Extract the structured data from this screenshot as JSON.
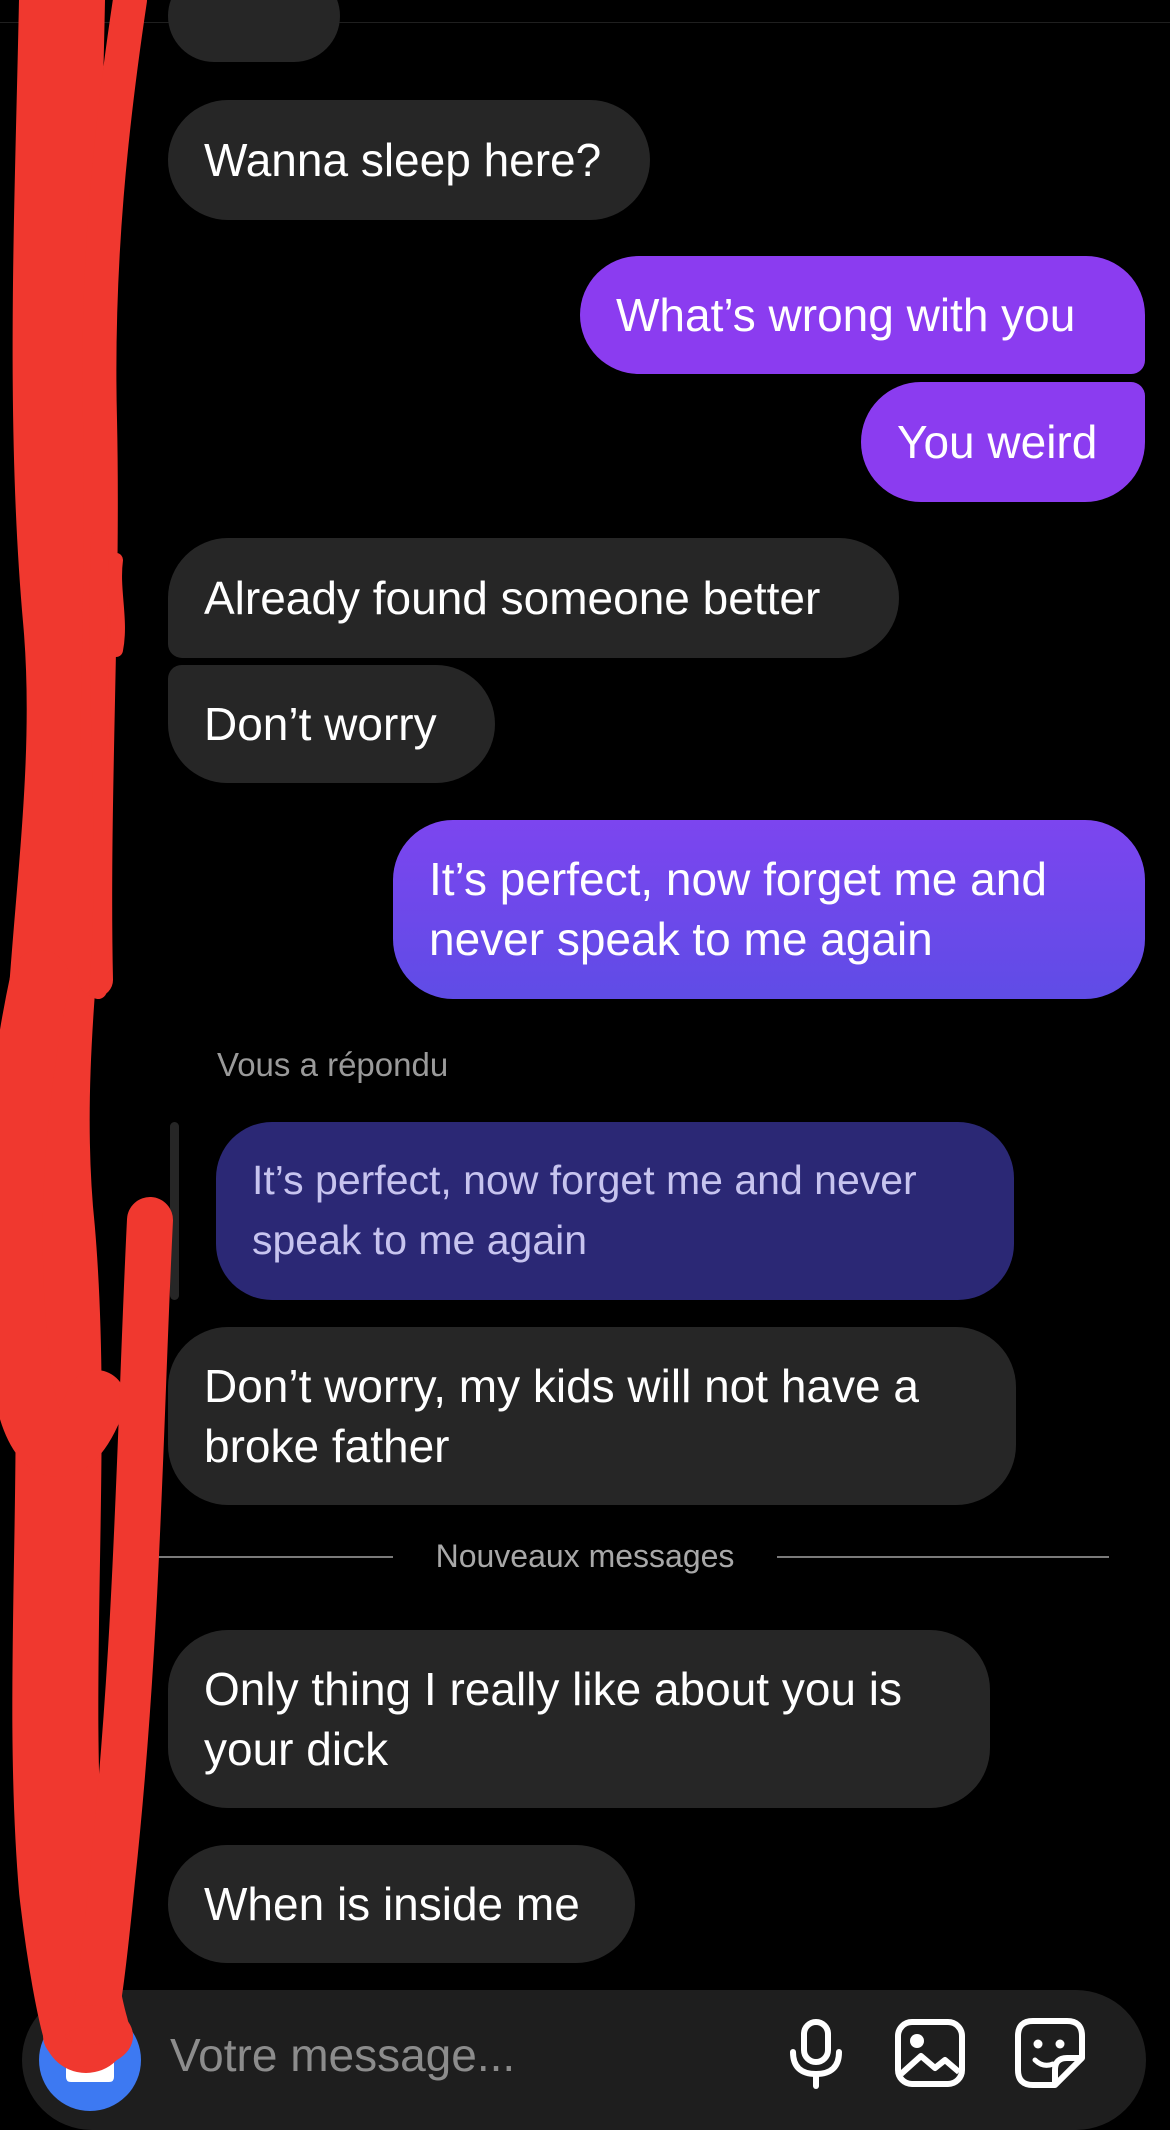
{
  "conversation": {
    "messages": [
      {
        "id": "m1",
        "direction": "received",
        "text": "Wanna sleep here?"
      },
      {
        "id": "m2",
        "direction": "sent",
        "text": "What’s wrong with you"
      },
      {
        "id": "m3",
        "direction": "sent",
        "text": "You weird"
      },
      {
        "id": "m4",
        "direction": "received",
        "text": "Already found someone better"
      },
      {
        "id": "m5",
        "direction": "received",
        "text": "Don’t worry"
      },
      {
        "id": "m6",
        "direction": "sent",
        "lines": [
          "It’s perfect, now forget me and",
          "never speak to me again"
        ]
      },
      {
        "id": "m7",
        "direction": "received",
        "lines": [
          "Don’t worry, my kids will not have a",
          "broke father"
        ]
      },
      {
        "id": "m8",
        "direction": "received",
        "lines": [
          "Only thing I really like about you is",
          "your dick"
        ]
      },
      {
        "id": "m9",
        "direction": "received",
        "text": "When is inside me"
      }
    ],
    "reply_context": {
      "label": "Vous a répondu",
      "quoted_lines": [
        "It’s perfect, now forget me and never",
        "speak to me again"
      ]
    },
    "new_messages_divider": "Nouveaux messages"
  },
  "composer": {
    "placeholder": "Votre message...",
    "icons": [
      "camera-icon",
      "microphone-icon",
      "gallery-icon",
      "sticker-icon"
    ]
  },
  "colors": {
    "background": "#000000",
    "received_bubble": "#262626",
    "sent_bubble": "#8b3cf0",
    "quoted_bubble": "#2b2875",
    "camera_button": "#3d79f2",
    "redaction": "#f0382f"
  }
}
